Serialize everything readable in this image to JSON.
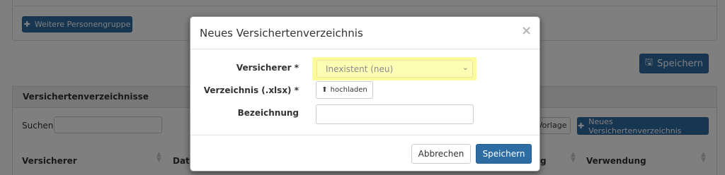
{
  "background": {
    "add_group_label": "Weitere Personengruppe",
    "save_label": "Speichern",
    "section_title": "Versichertenverzeichnisse",
    "search_label": "Suchen",
    "search_value": "",
    "template_label": "Vorlage",
    "new_directory_label": "Neues Versichertenverzeichnis",
    "columns": [
      "Versicherer",
      "Dat",
      "g",
      "Verwendung"
    ]
  },
  "modal": {
    "title": "Neues Versichertenverzeichnis",
    "close_glyph": "×",
    "fields": {
      "insurer_label": "Versicherer *",
      "insurer_value": "Inexistent (neu)",
      "directory_label": "Verzeichnis (.xlsx) *",
      "upload_label": "hochladen",
      "name_label": "Bezeichnung",
      "name_value": ""
    },
    "cancel_label": "Abbrechen",
    "submit_label": "Speichern"
  },
  "colors": {
    "primary": "#2e6da4",
    "highlight": "#fbfb9c",
    "overlay": "rgba(0,0,0,0.5)"
  },
  "icons": [
    "plus-icon",
    "floppy-disk-icon",
    "upload-icon",
    "close-icon",
    "chevron-down-icon",
    "sort-icon"
  ]
}
